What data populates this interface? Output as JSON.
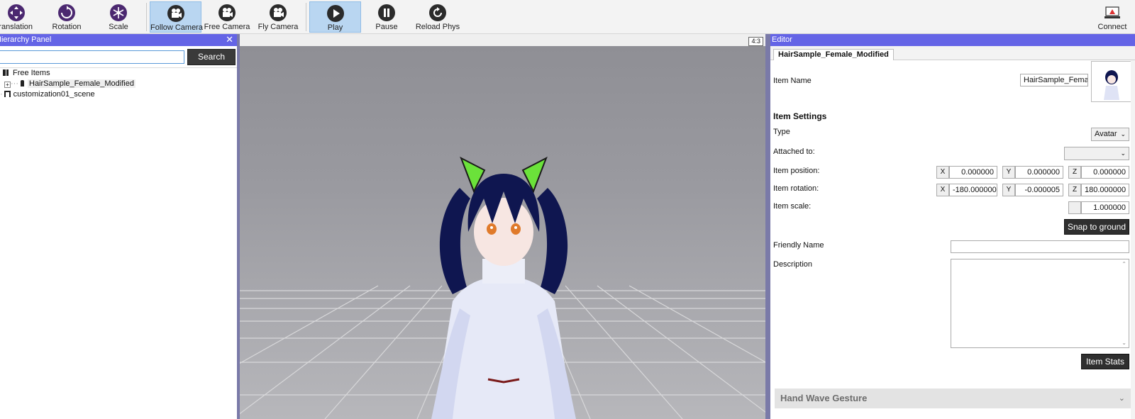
{
  "toolbar": {
    "translation": "Translation",
    "rotation": "Rotation",
    "scale": "Scale",
    "follow_camera": "Follow Camera",
    "free_camera": "Free Camera",
    "fly_camera": "Fly Camera",
    "play": "Play",
    "pause": "Pause",
    "reload_phys": "Reload Phys",
    "connect": "Connect",
    "active_buttons": [
      "Follow Camera",
      "Play"
    ]
  },
  "hierarchy": {
    "title": "Hierarchy Panel",
    "close": "✕",
    "search_value": "",
    "search_button": "Search",
    "tree": {
      "free_items": "Free Items",
      "hair_sample": "HairSample_Female_Modified",
      "scene": "customization01_scene"
    }
  },
  "viewport": {
    "aspect": "4:3"
  },
  "editor": {
    "title": "Editor",
    "tab": "HairSample_Female_Modified",
    "item_name_label": "Item Name",
    "item_name_value": "HairSample_Female_Modified",
    "item_settings": "Item Settings",
    "type_label": "Type",
    "type_value": "Avatar",
    "attached_label": "Attached to:",
    "attached_value": "",
    "position_label": "Item position:",
    "position": {
      "x": "0.000000",
      "y": "0.000000",
      "z": "0.000000"
    },
    "rotation_label": "Item rotation:",
    "rotation": {
      "x": "-180.000000",
      "y": "-0.000005",
      "z": "180.000000"
    },
    "scale_label": "Item scale:",
    "scale_value": "1.000000",
    "axis": {
      "x": "X",
      "y": "Y",
      "z": "Z"
    },
    "snap_button": "Snap to ground",
    "friendly_name_label": "Friendly Name",
    "friendly_name_value": "",
    "description_label": "Description",
    "description_value": "",
    "item_stats_button": "Item Stats",
    "gesture_section": "Hand Wave Gesture"
  },
  "colors": {
    "panel_header": "#6464e6",
    "toolbar_icon": "#4b2870",
    "active_button": "#b9d6f1",
    "dark_button": "#2f2f2f",
    "cat_ears": "#6be23a",
    "hair": "#0f1650"
  }
}
